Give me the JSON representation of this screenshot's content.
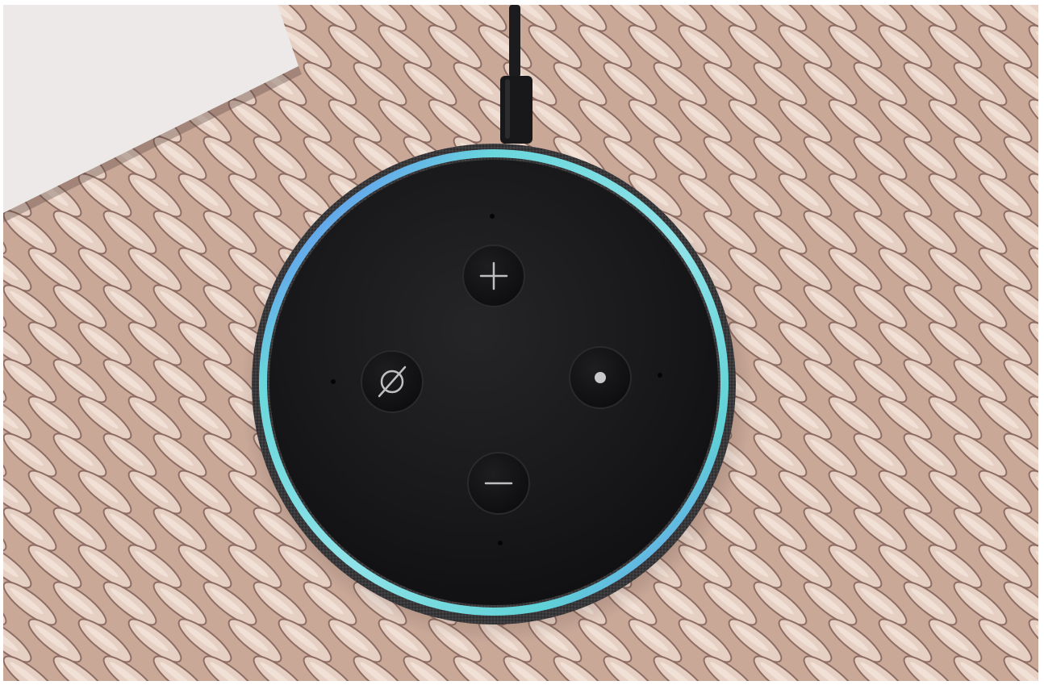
{
  "photo": {
    "subject": "smart-speaker-top-view",
    "surface": "woven-rattan-table",
    "colors": {
      "rattan_base": "#c9a898",
      "rattan_light": "#e6cfc3",
      "rattan_shadow": "#8e6e64",
      "paper": "#ece9e8",
      "fabric": "#3a3a3c",
      "top_plate": "#19191b",
      "button": "#131315",
      "light_ring_cyan": "#5fd1d6",
      "light_ring_blue": "#5a6cff",
      "cable": "#1c1c1e"
    },
    "buttons": [
      {
        "id": "volume-up",
        "icon": "plus-icon"
      },
      {
        "id": "microphone-off",
        "icon": "mic-off-icon"
      },
      {
        "id": "action",
        "icon": "dot-icon"
      },
      {
        "id": "volume-down",
        "icon": "minus-icon"
      }
    ]
  }
}
